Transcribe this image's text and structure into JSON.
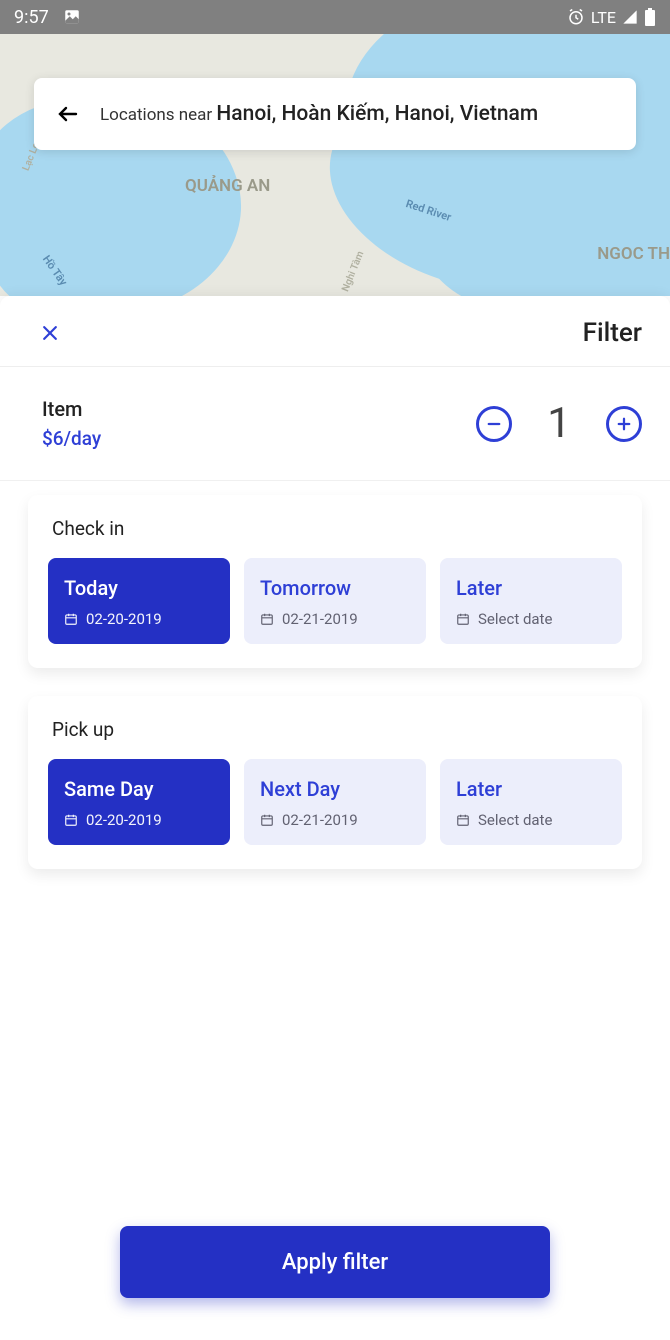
{
  "status": {
    "time": "9:57",
    "network": "LTE"
  },
  "search": {
    "prefix": "Locations near ",
    "location": "Hanoi, Hoàn Kiếm, Hanoi, Vietnam"
  },
  "map": {
    "label1": "QUẢNG AN",
    "label2": "NGOC TH",
    "river": "Red River",
    "road1": "Lạc Long Quân",
    "road2": "Nghi Tàm",
    "road3": "Hồ Tây"
  },
  "filter": {
    "title": "Filter",
    "item_label": "Item",
    "item_price": "$6/day",
    "quantity": "1",
    "apply_label": "Apply filter"
  },
  "checkin": {
    "title": "Check in",
    "options": [
      {
        "main": "Today",
        "sub": "02-20-2019"
      },
      {
        "main": "Tomorrow",
        "sub": "02-21-2019"
      },
      {
        "main": "Later",
        "sub": "Select date"
      }
    ]
  },
  "pickup": {
    "title": "Pick up",
    "options": [
      {
        "main": "Same Day",
        "sub": "02-20-2019"
      },
      {
        "main": "Next Day",
        "sub": "02-21-2019"
      },
      {
        "main": "Later",
        "sub": "Select date"
      }
    ]
  }
}
